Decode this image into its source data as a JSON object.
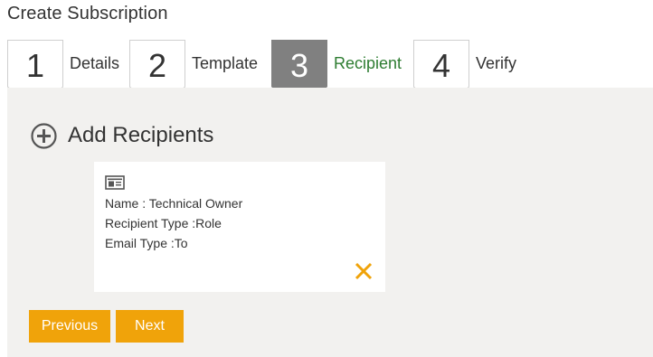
{
  "page": {
    "title": "Create Subscription"
  },
  "wizard": {
    "steps": [
      {
        "number": "1",
        "label": "Details",
        "state": "inactive"
      },
      {
        "number": "2",
        "label": "Template",
        "state": "inactive"
      },
      {
        "number": "3",
        "label": "Recipient",
        "state": "active"
      },
      {
        "number": "4",
        "label": "Verify",
        "state": "inactive"
      }
    ]
  },
  "recipients": {
    "add_label": "Add Recipients",
    "add_icon": "plus-circle-icon",
    "items": [
      {
        "icon": "contact-card-icon",
        "name_line": "Name : Technical Owner",
        "type_line": "Recipient Type :Role",
        "email_line": "Email Type :To",
        "remove_icon": "close-icon"
      }
    ]
  },
  "actions": {
    "previous_label": "Previous",
    "next_label": "Next"
  },
  "colors": {
    "accent": "#f0a30a",
    "active_step": "#808080",
    "active_label": "#2e7d32",
    "panel_bg": "#f2f1ef"
  }
}
